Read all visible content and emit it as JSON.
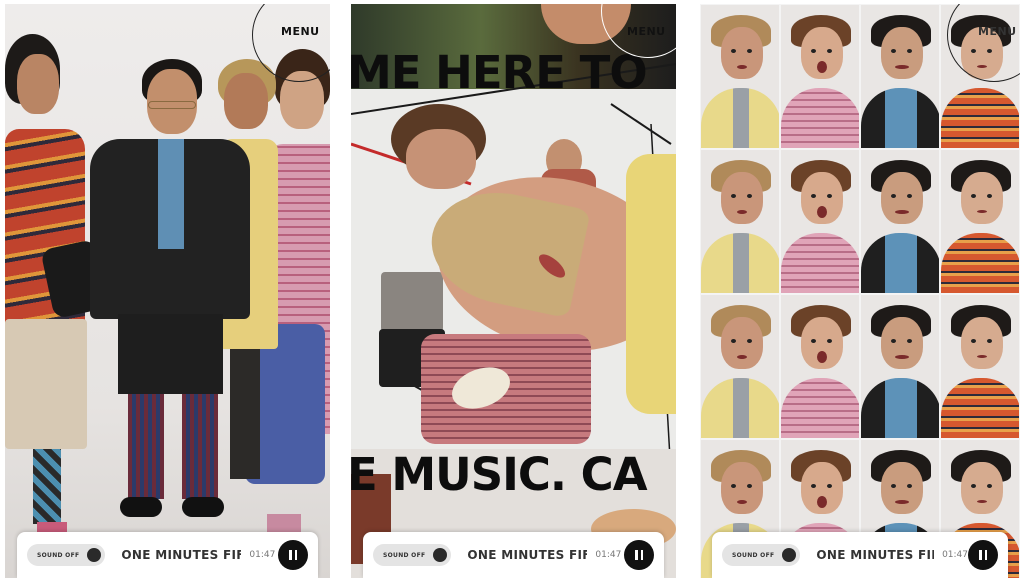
{
  "menu_label": "MENU",
  "player": {
    "sound_label": "SOUND OFF",
    "track_title": "ONE MINUTES FIF",
    "time": "01:47"
  },
  "hero_text": {
    "line1": "ME HERE TO",
    "line2": "E MUSIC. CA"
  },
  "colors": {
    "player_bg": "#ffffff",
    "pause_button": "#111111",
    "accent_text": "#0d0d0d"
  },
  "icons": [
    "pause-icon",
    "sound-toggle-knob"
  ]
}
